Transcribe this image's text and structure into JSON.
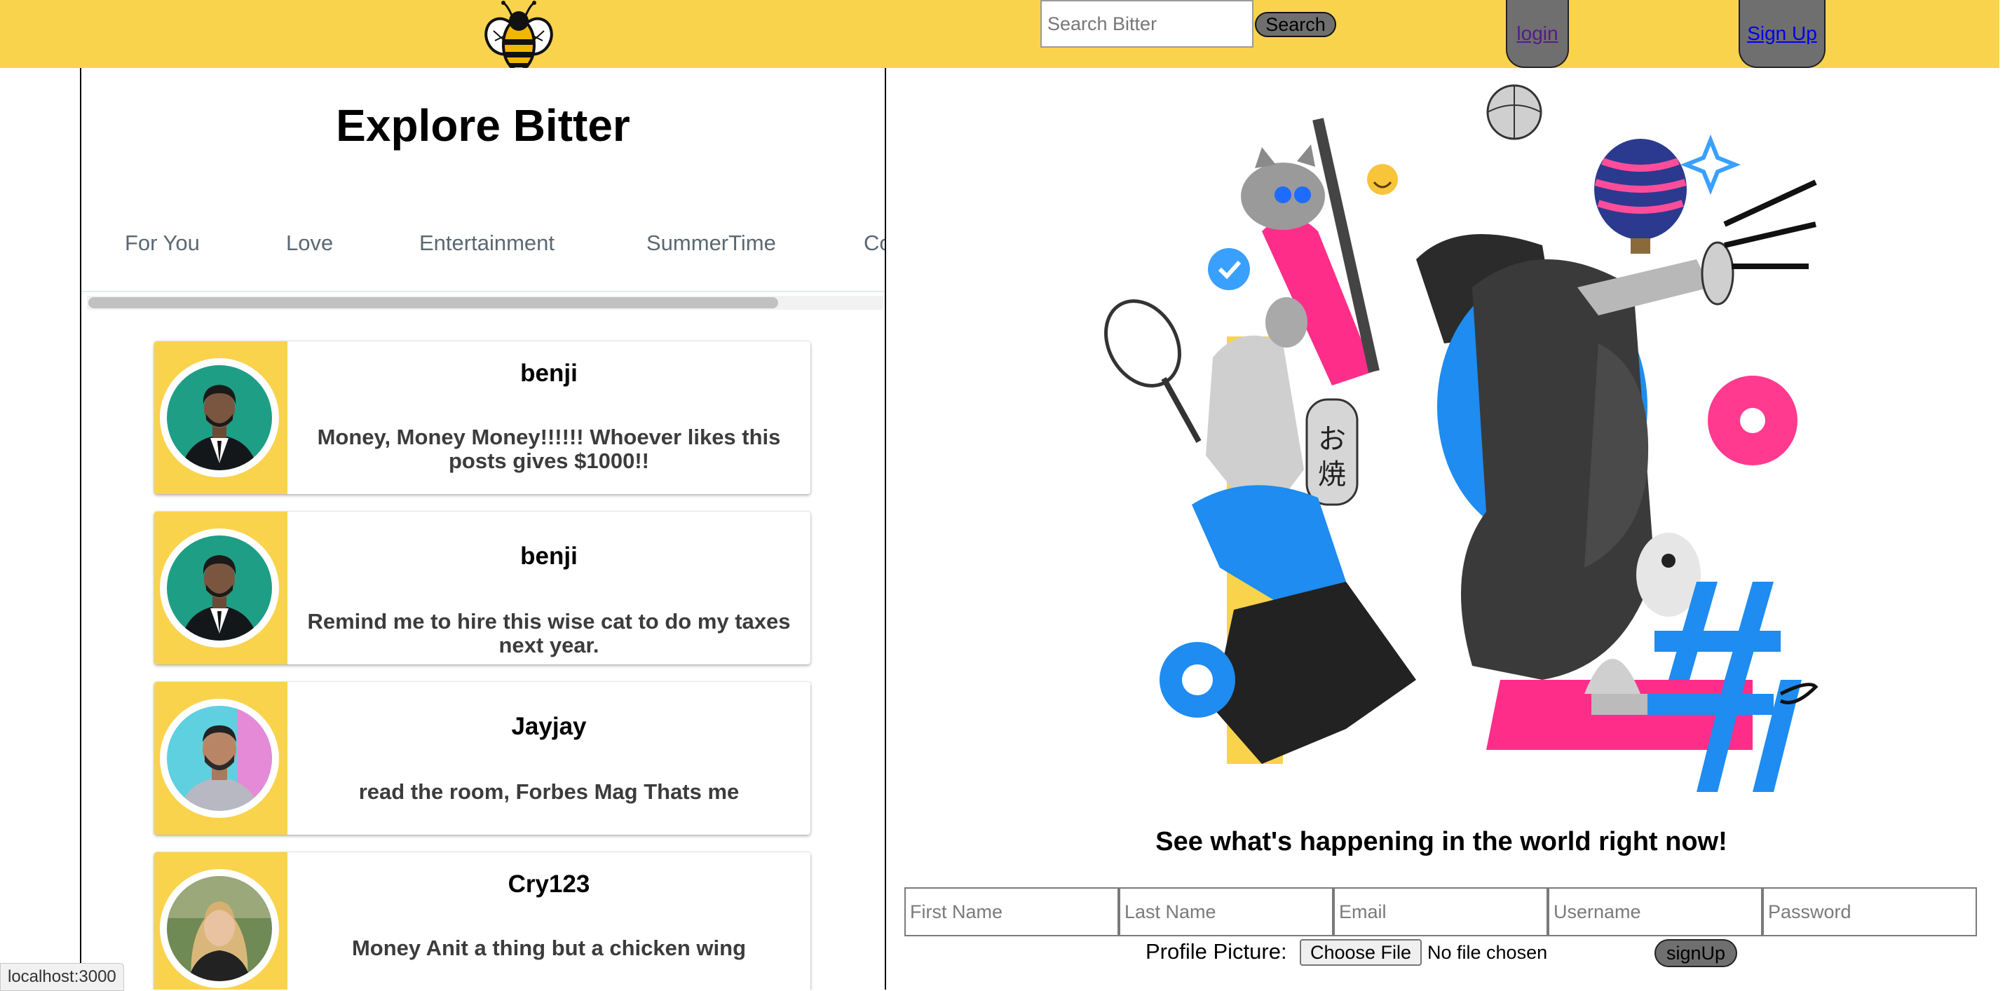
{
  "header": {
    "logo_icon": "bee-icon",
    "search_placeholder": "Search Bitter",
    "search_button": "Search",
    "login_link": "login",
    "signup_link": "Sign Up",
    "brand_color": "#f9d34c"
  },
  "explore": {
    "title": "Explore Bitter",
    "tabs": [
      "For You",
      "Love",
      "Entertainment",
      "SummerTime",
      "Co"
    ],
    "posts": [
      {
        "user": "benji",
        "text": "Money, Money Money!!!!!! Whoever likes this posts gives $1000!!"
      },
      {
        "user": "benji",
        "text": "Remind me to hire this wise cat to do my taxes next year."
      },
      {
        "user": "Jayjay",
        "text": "read the room, Forbes Mag Thats me"
      },
      {
        "user": "Cry123",
        "text": "Money Anit a thing but a chicken wing"
      }
    ]
  },
  "signup": {
    "tagline": "See what's happening in the world right now!",
    "fields": {
      "first_name": "First Name",
      "last_name": "Last Name",
      "email": "Email",
      "username": "Username",
      "password": "Password"
    },
    "profile_picture_label": "Profile Picture:",
    "choose_file_button": "Choose File",
    "no_file_text": "No file chosen",
    "submit_button": "signUp"
  },
  "status_bar": {
    "url": "localhost:3000"
  }
}
